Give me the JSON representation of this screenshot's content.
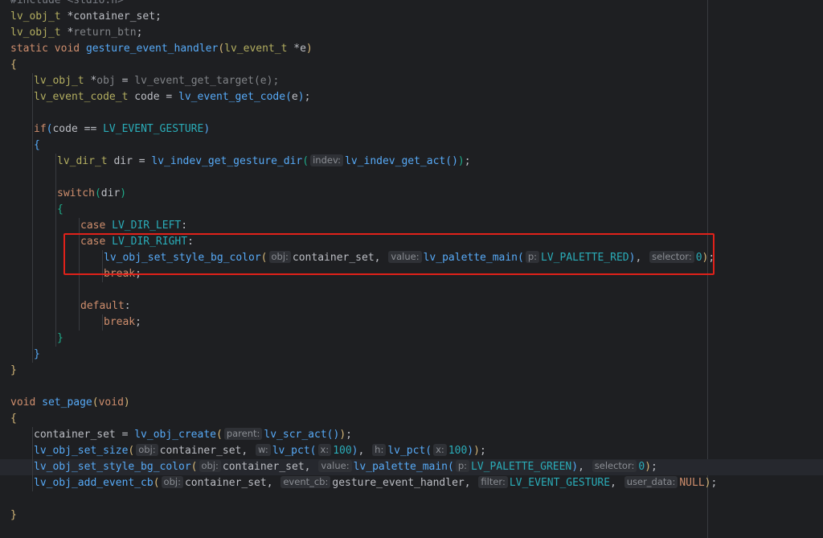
{
  "editor": {
    "language": "C",
    "current_line_index": 29,
    "highlight": {
      "color": "#e0211a",
      "label": ""
    },
    "lines": [
      {
        "indent": 0,
        "tokens": [
          {
            "t": "#include <stdio.h>",
            "c": "cm"
          }
        ]
      },
      {
        "indent": 0,
        "tokens": [
          {
            "t": "lv_obj_t",
            "c": "ty"
          },
          {
            "t": " *container_set;",
            "c": "t"
          }
        ]
      },
      {
        "indent": 0,
        "tokens": [
          {
            "t": "lv_obj_t",
            "c": "ty"
          },
          {
            "t": " *",
            "c": "t"
          },
          {
            "t": "return_btn",
            "c": "pv"
          },
          {
            "t": ";",
            "c": "t"
          }
        ]
      },
      {
        "indent": 0,
        "tokens": [
          {
            "t": "static",
            "c": "kw"
          },
          {
            "t": " ",
            "c": "t"
          },
          {
            "t": "void",
            "c": "kw"
          },
          {
            "t": " ",
            "c": "t"
          },
          {
            "t": "gesture_event_handler",
            "c": "fn"
          },
          {
            "t": "(",
            "c": "br1"
          },
          {
            "t": "lv_event_t",
            "c": "ty"
          },
          {
            "t": " *e",
            "c": "t"
          },
          {
            "t": ")",
            "c": "br1"
          }
        ]
      },
      {
        "indent": 0,
        "tokens": [
          {
            "t": "{",
            "c": "br0"
          }
        ]
      },
      {
        "indent": 1,
        "tokens": [
          {
            "t": "lv_obj_t",
            "c": "ty"
          },
          {
            "t": " *",
            "c": "t"
          },
          {
            "t": "obj",
            "c": "pv"
          },
          {
            "t": " = ",
            "c": "t"
          },
          {
            "t": "lv_event_get_target",
            "c": "pv"
          },
          {
            "t": "(e);",
            "c": "pv"
          }
        ]
      },
      {
        "indent": 1,
        "tokens": [
          {
            "t": "lv_event_code_t",
            "c": "ty"
          },
          {
            "t": " code = ",
            "c": "t"
          },
          {
            "t": "lv_event_get_code",
            "c": "fn"
          },
          {
            "t": "(",
            "c": "br2"
          },
          {
            "t": "e",
            "c": "t"
          },
          {
            "t": ")",
            "c": "br2"
          },
          {
            "t": ";",
            "c": "t"
          }
        ]
      },
      {
        "indent": 0,
        "tokens": []
      },
      {
        "indent": 1,
        "tokens": [
          {
            "t": "if",
            "c": "kw"
          },
          {
            "t": "(",
            "c": "br2"
          },
          {
            "t": "code == ",
            "c": "t"
          },
          {
            "t": "LV_EVENT_GESTURE",
            "c": "m"
          },
          {
            "t": ")",
            "c": "br2"
          }
        ]
      },
      {
        "indent": 1,
        "tokens": [
          {
            "t": "{",
            "c": "br2"
          }
        ]
      },
      {
        "indent": 2,
        "tokens": [
          {
            "t": "lv_dir_t",
            "c": "ty"
          },
          {
            "t": " dir = ",
            "c": "t"
          },
          {
            "t": "lv_indev_get_gesture_dir",
            "c": "fn"
          },
          {
            "t": "(",
            "c": "br3"
          },
          {
            "hint": "indev:"
          },
          {
            "t": "lv_indev_get_act",
            "c": "fn"
          },
          {
            "t": "()",
            "c": "br2"
          },
          {
            "t": ")",
            "c": "br3"
          },
          {
            "t": ";",
            "c": "t"
          }
        ]
      },
      {
        "indent": 0,
        "tokens": []
      },
      {
        "indent": 2,
        "tokens": [
          {
            "t": "switch",
            "c": "kw"
          },
          {
            "t": "(",
            "c": "br3"
          },
          {
            "t": "dir",
            "c": "t"
          },
          {
            "t": ")",
            "c": "br3"
          }
        ]
      },
      {
        "indent": 2,
        "tokens": [
          {
            "t": "{",
            "c": "br3"
          }
        ]
      },
      {
        "indent": 3,
        "tokens": [
          {
            "t": "case",
            "c": "kw"
          },
          {
            "t": " ",
            "c": "t"
          },
          {
            "t": "LV_DIR_LEFT",
            "c": "m"
          },
          {
            "t": ":",
            "c": "t"
          }
        ]
      },
      {
        "indent": 3,
        "tokens": [
          {
            "t": "case",
            "c": "kw"
          },
          {
            "t": " ",
            "c": "t"
          },
          {
            "t": "LV_DIR_RIGHT",
            "c": "m"
          },
          {
            "t": ":",
            "c": "t"
          }
        ]
      },
      {
        "indent": 4,
        "tokens": [
          {
            "t": "lv_obj_set_style_bg_color",
            "c": "fn"
          },
          {
            "t": "(",
            "c": "br1"
          },
          {
            "hint": "obj:"
          },
          {
            "t": "container_set,",
            "c": "t"
          },
          {
            "t": " ",
            "c": "t"
          },
          {
            "hint": "value:"
          },
          {
            "t": "lv_palette_main",
            "c": "fn"
          },
          {
            "t": "(",
            "c": "br2"
          },
          {
            "hint": "p:"
          },
          {
            "t": "LV_PALETTE_RED",
            "c": "m"
          },
          {
            "t": ")",
            "c": "br2"
          },
          {
            "t": ", ",
            "c": "t"
          },
          {
            "hint": "selector:"
          },
          {
            "t": "0",
            "c": "num"
          },
          {
            "t": ")",
            "c": "br1"
          },
          {
            "t": ";",
            "c": "t"
          }
        ]
      },
      {
        "indent": 4,
        "tokens": [
          {
            "t": "break",
            "c": "kw"
          },
          {
            "t": ";",
            "c": "t"
          }
        ]
      },
      {
        "indent": 0,
        "tokens": []
      },
      {
        "indent": 3,
        "tokens": [
          {
            "t": "default",
            "c": "kw"
          },
          {
            "t": ":",
            "c": "t"
          }
        ]
      },
      {
        "indent": 4,
        "tokens": [
          {
            "t": "break",
            "c": "kw"
          },
          {
            "t": ";",
            "c": "t"
          }
        ]
      },
      {
        "indent": 2,
        "tokens": [
          {
            "t": "}",
            "c": "br3"
          }
        ]
      },
      {
        "indent": 1,
        "tokens": [
          {
            "t": "}",
            "c": "br2"
          }
        ]
      },
      {
        "indent": 0,
        "tokens": [
          {
            "t": "}",
            "c": "br0"
          }
        ]
      },
      {
        "indent": 0,
        "tokens": []
      },
      {
        "indent": 0,
        "tokens": [
          {
            "t": "void",
            "c": "kw"
          },
          {
            "t": " ",
            "c": "t"
          },
          {
            "t": "set_page",
            "c": "fn"
          },
          {
            "t": "(",
            "c": "br1"
          },
          {
            "t": "void",
            "c": "kw"
          },
          {
            "t": ")",
            "c": "br1"
          }
        ]
      },
      {
        "indent": 0,
        "tokens": [
          {
            "t": "{",
            "c": "br0"
          }
        ]
      },
      {
        "indent": 1,
        "tokens": [
          {
            "t": "container_set = ",
            "c": "t"
          },
          {
            "t": "lv_obj_create",
            "c": "fn"
          },
          {
            "t": "(",
            "c": "br1"
          },
          {
            "hint": "parent:"
          },
          {
            "t": "lv_scr_act",
            "c": "fn"
          },
          {
            "t": "()",
            "c": "br2"
          },
          {
            "t": ")",
            "c": "br1"
          },
          {
            "t": ";",
            "c": "t"
          }
        ]
      },
      {
        "indent": 1,
        "tokens": [
          {
            "t": "lv_obj_set_size",
            "c": "fn"
          },
          {
            "t": "(",
            "c": "br1"
          },
          {
            "hint": "obj:"
          },
          {
            "t": "container_set,",
            "c": "t"
          },
          {
            "t": " ",
            "c": "t"
          },
          {
            "hint": "w:"
          },
          {
            "t": "lv_pct",
            "c": "fn"
          },
          {
            "t": "(",
            "c": "br2"
          },
          {
            "hint": "x:"
          },
          {
            "t": "100",
            "c": "num"
          },
          {
            "t": ")",
            "c": "br2"
          },
          {
            "t": ", ",
            "c": "t"
          },
          {
            "hint": "h:"
          },
          {
            "t": "lv_pct",
            "c": "fn"
          },
          {
            "t": "(",
            "c": "br2"
          },
          {
            "hint": "x:"
          },
          {
            "t": "100",
            "c": "num"
          },
          {
            "t": ")",
            "c": "br2"
          },
          {
            "t": ")",
            "c": "br1"
          },
          {
            "t": ";",
            "c": "t"
          }
        ]
      },
      {
        "indent": 1,
        "tokens": [
          {
            "t": "lv_obj_set_style_bg_color",
            "c": "fn"
          },
          {
            "t": "(",
            "c": "br1"
          },
          {
            "hint": "obj:"
          },
          {
            "t": "container_set,",
            "c": "t"
          },
          {
            "t": " ",
            "c": "t"
          },
          {
            "hint": "value:"
          },
          {
            "t": "lv_palette_main",
            "c": "fn"
          },
          {
            "t": "(",
            "c": "br2"
          },
          {
            "hint": "p:"
          },
          {
            "t": "LV_PALETTE_GREEN",
            "c": "m"
          },
          {
            "t": ")",
            "c": "br2"
          },
          {
            "t": ", ",
            "c": "t"
          },
          {
            "hint": "selector:"
          },
          {
            "t": "0",
            "c": "num"
          },
          {
            "t": ")",
            "c": "br1"
          },
          {
            "t": ";",
            "c": "t"
          }
        ]
      },
      {
        "indent": 1,
        "tokens": [
          {
            "t": "lv_obj_add_event_cb",
            "c": "fn"
          },
          {
            "t": "(",
            "c": "br1"
          },
          {
            "hint": "obj:"
          },
          {
            "t": "container_set,",
            "c": "t"
          },
          {
            "t": " ",
            "c": "t"
          },
          {
            "hint": "event_cb:"
          },
          {
            "t": "gesture_event_handler,",
            "c": "t"
          },
          {
            "t": " ",
            "c": "t"
          },
          {
            "hint": "filter:"
          },
          {
            "t": "LV_EVENT_GESTURE",
            "c": "m"
          },
          {
            "t": ",",
            "c": "t"
          },
          {
            "t": " ",
            "c": "t"
          },
          {
            "hint": "user_data:"
          },
          {
            "t": "NULL",
            "c": "kw"
          },
          {
            "t": ")",
            "c": "br1"
          },
          {
            "t": ";",
            "c": "t"
          }
        ]
      },
      {
        "indent": 0,
        "tokens": []
      },
      {
        "indent": 0,
        "tokens": [
          {
            "t": "}",
            "c": "br0"
          }
        ]
      }
    ]
  }
}
